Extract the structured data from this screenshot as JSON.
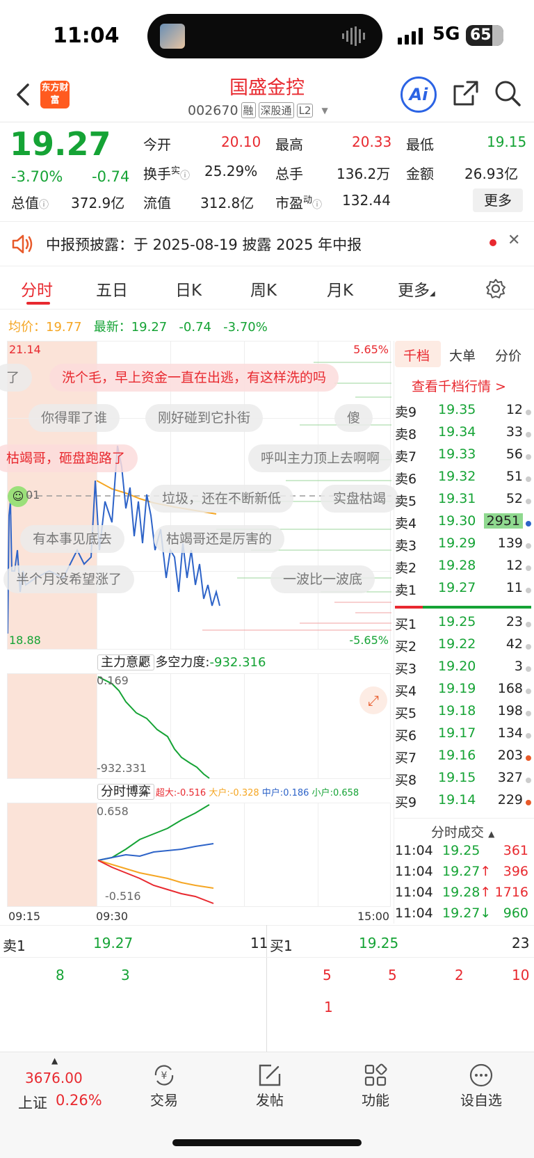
{
  "status_bar": {
    "time": "11:04",
    "network": "5G",
    "battery": "65"
  },
  "header": {
    "stock_name": "国盛金控",
    "stock_code": "002670",
    "tags": [
      "融",
      "深股通",
      "L2"
    ],
    "logo_text": "东方财富",
    "ai_label": "Ai"
  },
  "quote": {
    "price": "19.27",
    "change_pct": "-3.70%",
    "change": "-0.74",
    "open_label": "今开",
    "open": "20.10",
    "high_label": "最高",
    "high": "20.33",
    "low_label": "最低",
    "low": "19.15",
    "turnover_label": "换手",
    "turnover_sup": "实",
    "turnover": "25.29%",
    "volume_label": "总手",
    "volume": "136.2万",
    "amount_label": "金额",
    "amount": "26.93亿",
    "mktcap_label": "总值",
    "mktcap": "372.9亿",
    "float_label": "流值",
    "float_cap": "312.8亿",
    "pe_label": "市盈",
    "pe_sup": "动",
    "pe": "132.44",
    "more_label": "更多"
  },
  "notice": {
    "text": "中报预披露：于 2025-08-19 披露 2025 年中报"
  },
  "tabs": [
    "分时",
    "五日",
    "日K",
    "周K",
    "月K",
    "更多"
  ],
  "intraday": {
    "avg_label": "均价：",
    "avg": "19.77",
    "last_label": "最新：",
    "last": "19.27",
    "last_chg": "-0.74",
    "last_pct": "-3.70%",
    "y_top": "21.14",
    "y_bottom": "18.88",
    "pct_top": "5.65%",
    "pct_bottom": "-5.65%",
    "ref_partial": "01"
  },
  "danmu": [
    "了",
    "洗个毛，早上资金一直在出逃，有这样洗的吗",
    "你得罪了谁",
    "刚好碰到它扑街",
    "傻",
    "枯竭哥，砸盘跑路了",
    "呼叫主力顶上去啊啊",
    "垃圾，还在不断新低",
    "实盘枯竭",
    "有本事见底去",
    "枯竭哥还是厉害的",
    "半个月没希望涨了",
    "一波比一波底"
  ],
  "main_force": {
    "label": "主力意愿",
    "power_label": "多空力度:",
    "power": "-932.316",
    "top": "0.169",
    "bottom": "-932.331"
  },
  "game": {
    "label": "分时博弈",
    "legend": [
      {
        "name": "超大",
        "value": "-0.516",
        "color": "#e8292f"
      },
      {
        "name": "大户",
        "value": "-0.328",
        "color": "#f5a623"
      },
      {
        "name": "中户",
        "value": "0.186",
        "color": "#2d63c8"
      },
      {
        "name": "小户",
        "value": "0.658",
        "color": "#15a335"
      }
    ],
    "top": "0.658",
    "bottom": "-0.516"
  },
  "time_axis": [
    "09:15",
    "09:30",
    "15:00"
  ],
  "order_book": {
    "tabs": [
      "千档",
      "大单",
      "分价"
    ],
    "link": "查看千档行情 >",
    "asks": [
      {
        "label": "卖9",
        "price": "19.35",
        "vol": "12"
      },
      {
        "label": "卖8",
        "price": "19.34",
        "vol": "33"
      },
      {
        "label": "卖7",
        "price": "19.33",
        "vol": "56"
      },
      {
        "label": "卖6",
        "price": "19.32",
        "vol": "51"
      },
      {
        "label": "卖5",
        "price": "19.31",
        "vol": "52"
      },
      {
        "label": "卖4",
        "price": "19.30",
        "vol": "2951"
      },
      {
        "label": "卖3",
        "price": "19.29",
        "vol": "139"
      },
      {
        "label": "卖2",
        "price": "19.28",
        "vol": "12"
      },
      {
        "label": "卖1",
        "price": "19.27",
        "vol": "11"
      }
    ],
    "bids": [
      {
        "label": "买1",
        "price": "19.25",
        "vol": "23"
      },
      {
        "label": "买2",
        "price": "19.22",
        "vol": "42"
      },
      {
        "label": "买3",
        "price": "19.20",
        "vol": "3"
      },
      {
        "label": "买4",
        "price": "19.19",
        "vol": "168"
      },
      {
        "label": "买5",
        "price": "19.18",
        "vol": "198"
      },
      {
        "label": "买6",
        "price": "19.17",
        "vol": "134"
      },
      {
        "label": "买7",
        "price": "19.16",
        "vol": "203"
      },
      {
        "label": "买8",
        "price": "19.15",
        "vol": "327"
      },
      {
        "label": "买9",
        "price": "19.14",
        "vol": "229"
      }
    ],
    "ticks_label": "分时成交",
    "ticks": [
      {
        "time": "11:04",
        "price": "19.25",
        "dir": "",
        "vol": "361",
        "color": "#e8292f",
        "pcolor": "#15a335"
      },
      {
        "time": "11:04",
        "price": "19.27",
        "dir": "↑",
        "vol": "396",
        "color": "#e8292f",
        "pcolor": "#15a335"
      },
      {
        "time": "11:04",
        "price": "19.28",
        "dir": "↑",
        "vol": "1716",
        "color": "#e8292f",
        "pcolor": "#15a335"
      },
      {
        "time": "11:04",
        "price": "19.27",
        "dir": "↓",
        "vol": "960",
        "color": "#15a335",
        "pcolor": "#15a335"
      }
    ]
  },
  "queue": {
    "ask_label": "卖1",
    "ask_price": "19.27",
    "ask_vol": "11",
    "bid_label": "买1",
    "bid_price": "19.25",
    "bid_vol": "23",
    "ask_orders": [
      "8",
      "3"
    ],
    "bid_orders": [
      "5",
      "5",
      "2",
      "10",
      "1"
    ]
  },
  "bottom_nav": {
    "index_value": "3676.00",
    "index_name": "上证",
    "index_pct": "0.26%",
    "items": [
      "交易",
      "发帖",
      "功能",
      "设自选"
    ]
  }
}
